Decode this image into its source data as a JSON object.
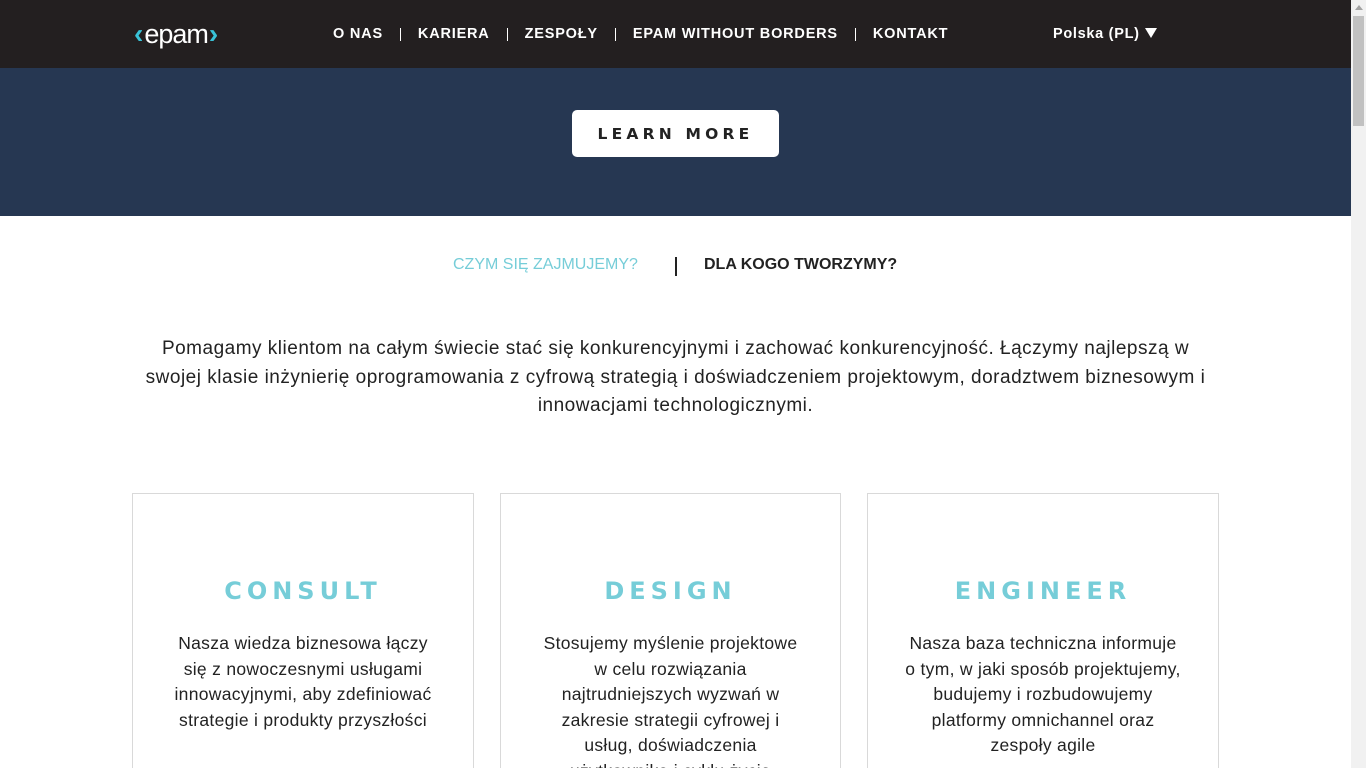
{
  "header": {
    "logo_text": "epam",
    "logo_left": "‹",
    "logo_right": "›",
    "nav": [
      {
        "label": "O NAS"
      },
      {
        "label": "KARIERA"
      },
      {
        "label": "ZESPOŁY"
      },
      {
        "label": "EPAM WITHOUT BORDERS"
      },
      {
        "label": "KONTAKT"
      }
    ],
    "language": "Polska (PL)"
  },
  "hero": {
    "button_label": "LEARN MORE"
  },
  "tabs": {
    "active": "CZYM SIĘ ZAJMUJEMY?",
    "inactive": "DLA KOGO TWORZYMY?"
  },
  "intro_text": "Pomagamy klientom na całym świecie stać się konkurencyjnymi i zachować konkurencyjność. Łączymy najlepszą w swojej klasie inżynierię oprogramowania z cyfrową strategią i doświadczeniem projektowym, doradztwem biznesowym i innowacjami technologicznymi.",
  "cards": [
    {
      "title": "CONSULT",
      "text": "Nasza wiedza biznesowa łączy się z nowoczesnymi usługami innowacyjnymi, aby zdefiniować strategie i produkty przyszłości"
    },
    {
      "title": "DESIGN",
      "text": "Stosujemy myślenie projektowe w celu rozwiązania najtrudniejszych wyzwań w zakresie strategii cyfrowej i usług, doświadczenia użytkownika i cyklu życia"
    },
    {
      "title": "ENGINEER",
      "text": "Nasza baza techniczna informuje o tym, w jaki sposób projektujemy, budujemy i rozbudowujemy platformy omnichannel oraz zespoły agile"
    }
  ],
  "colors": {
    "header_bg": "#231f20",
    "hero_bg": "#263752",
    "accent": "#76cdd8",
    "logo_accent": "#39c2d7"
  }
}
